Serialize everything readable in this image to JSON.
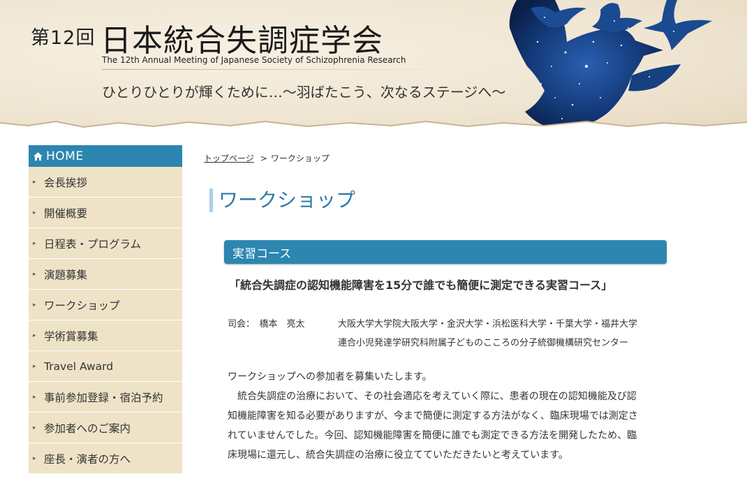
{
  "header": {
    "title_prefix": "第12回",
    "title_main": "日本統合失調症学会",
    "subtitle_en": "The 12th Annual Meeting of Japanese Society of Schizophrenia Research",
    "tagline": "ひとりひとりが輝くために…〜羽ばたこう、次なるステージへ〜"
  },
  "sidebar": {
    "home_label": "HOME",
    "items": [
      {
        "label": "会長挨拶"
      },
      {
        "label": "開催概要"
      },
      {
        "label": "日程表・プログラム"
      },
      {
        "label": "演題募集"
      },
      {
        "label": "ワークショップ"
      },
      {
        "label": "学術賞募集"
      },
      {
        "label": "Travel Award"
      },
      {
        "label": "事前参加登録・宿泊予約"
      },
      {
        "label": "参加者へのご案内"
      },
      {
        "label": "座長・演者の方へ"
      }
    ]
  },
  "breadcrumb": {
    "home": "トップページ",
    "separator": ">",
    "current": "ワークショップ"
  },
  "main": {
    "page_title": "ワークショップ",
    "section_heading": "実習コース",
    "course_title": "「統合失調症の認知機能障害を15分で誰でも簡便に測定できる実習コース」",
    "chair_label": "司会：　橋本　亮太",
    "chair_affiliation_line1": "大阪大学大学院大阪大学・金沢大学・浜松医科大学・千葉大学・福井大学",
    "chair_affiliation_line2": "連合小児発達学研究科附属子どものこころの分子統御機構研究センター",
    "intro": "ワークショップへの参加者を募集いたします。",
    "body_lines": [
      "統合失調症の治療において、その社会適応を考えていく際に、患者の現在の認知機能及び認",
      "知機能障害を知る必要がありますが、今まで簡便に測定する方法がなく、臨床現場では測定さ",
      "れていませんでした。今回、認知機能障害を簡便に誰でも測定できる方法を開発したため、臨",
      "床現場に還元し、統合失調症の治療に役立てていただきたいと考えています。"
    ]
  },
  "colors": {
    "accent_blue": "#2c86b0",
    "nav_bg": "#efe3c7",
    "title_blue": "#2b7aa6",
    "header_bg": "#efe5d2"
  },
  "icons": {
    "home": "house-icon",
    "nav_bullet": "chevron-right-icon"
  }
}
